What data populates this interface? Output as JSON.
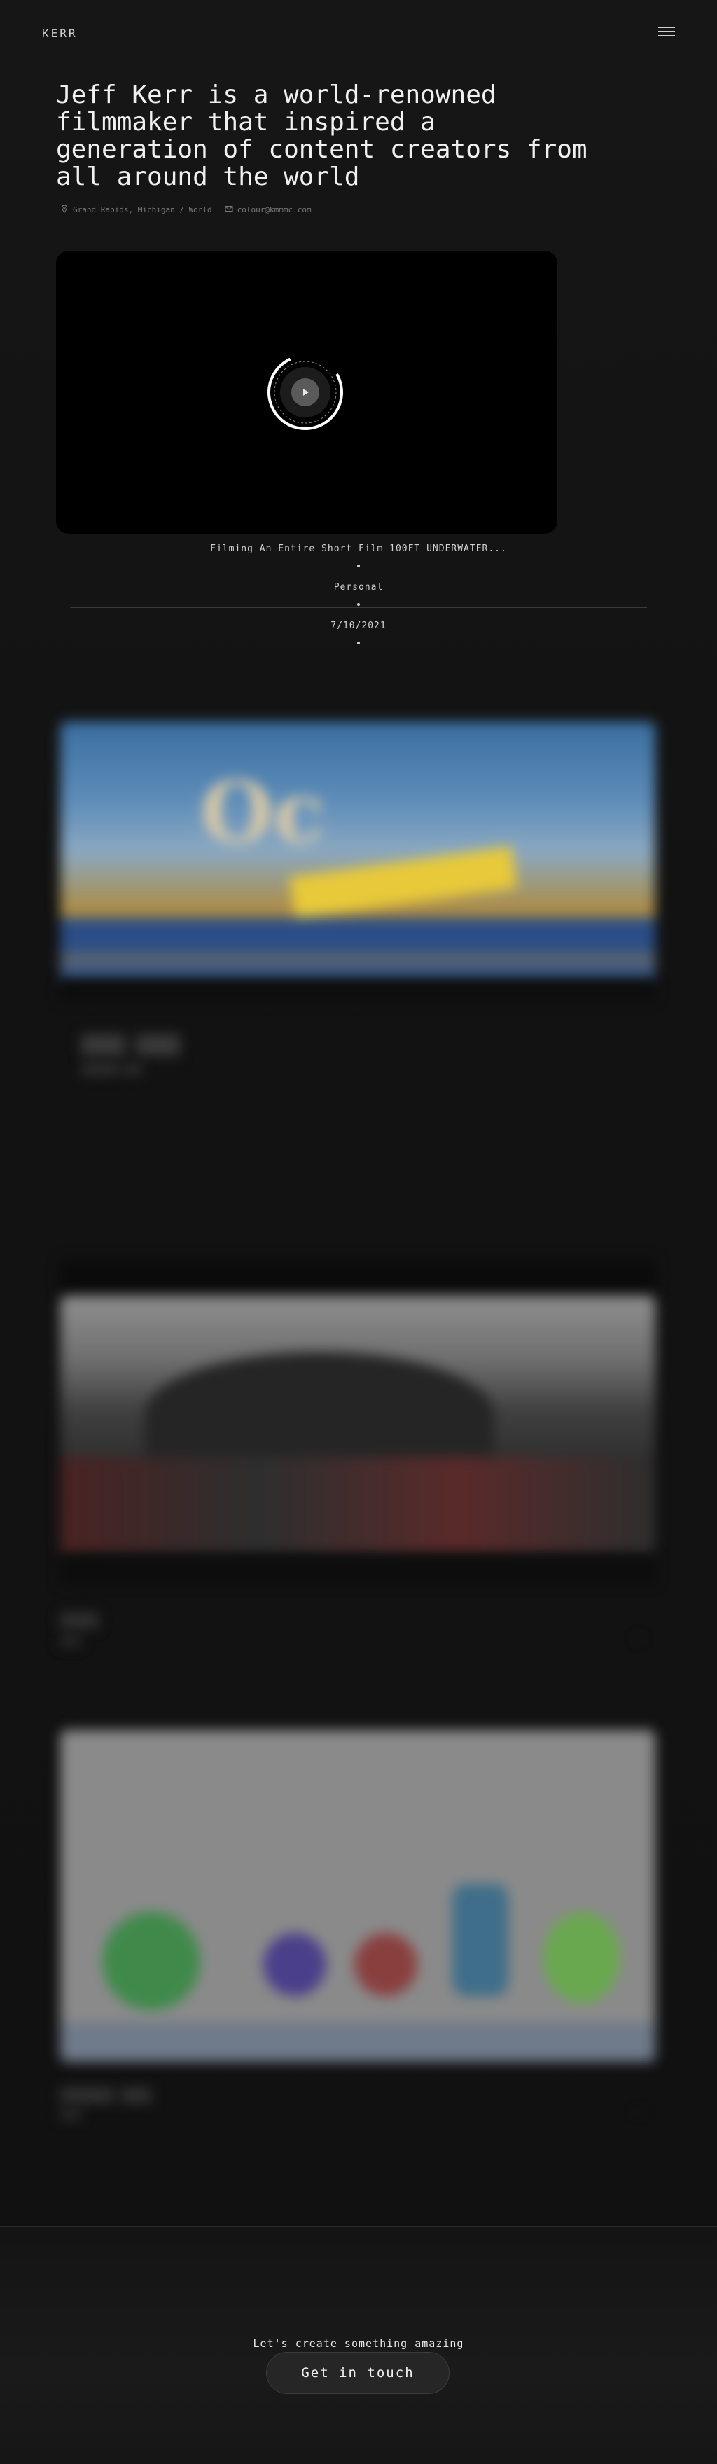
{
  "header": {
    "logo": "KERR",
    "menu_icon": "hamburger-menu-icon"
  },
  "hero": {
    "title": "Jeff Kerr is a world-renowned filmmaker that inspired a generation of content creators from all around the world",
    "location": "Grand Rapids, Michigan / World",
    "email": "colour@kmmmc.com",
    "location_icon": "map-pin-icon",
    "email_icon": "envelope-icon"
  },
  "video": {
    "play_icon": "play-icon",
    "title": "Filming An Entire Short Film 100FT UNDERWATER...",
    "category": "Personal",
    "date": "7/10/2021"
  },
  "footer": {
    "cta_text": "Let's create something amazing",
    "cta_button": "Get in touch"
  },
  "colors": {
    "background": "#141414",
    "text": "#e6e6e6",
    "muted": "#7b7b7b",
    "button_bg": "#262626"
  }
}
